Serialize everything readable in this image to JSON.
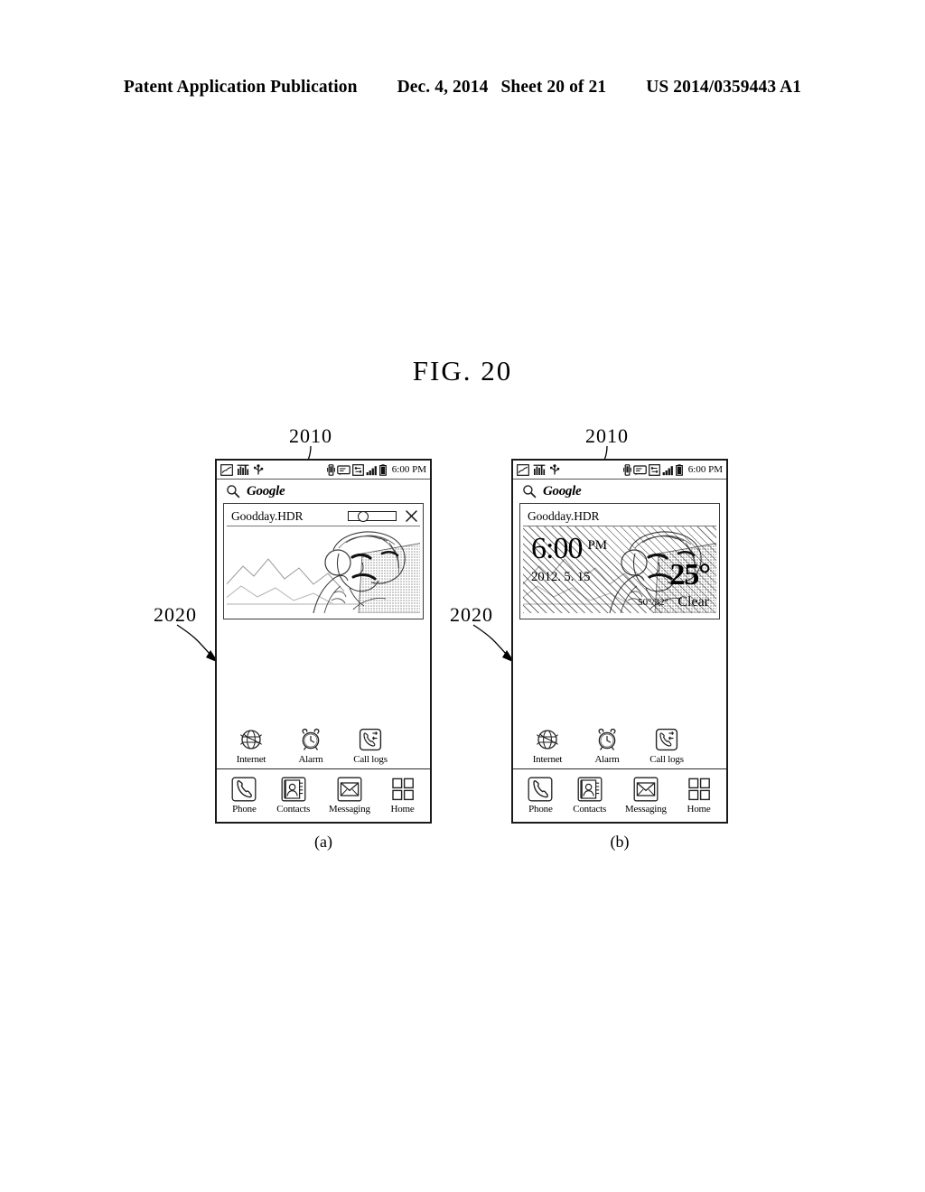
{
  "header": {
    "publication": "Patent Application Publication",
    "date": "Dec. 4, 2014",
    "sheet": "Sheet 20 of 21",
    "number": "US 2014/0359443 A1"
  },
  "figure": {
    "title": "FIG. 20",
    "ref_2010": "2010",
    "ref_2020": "2020",
    "caption_a": "(a)",
    "caption_b": "(b)"
  },
  "status_bar": {
    "left_icons": [
      "image-icon",
      "equalizer-icon",
      "usb-icon"
    ],
    "right_icons": [
      "vibrate-icon",
      "message-icon",
      "sync-icon",
      "signal-icon",
      "battery-icon"
    ],
    "time": "6:00 PM"
  },
  "search": {
    "icon": "search-icon",
    "label": "Google"
  },
  "viewer": {
    "filename": "Goodday.HDR",
    "slider_position_percent": 30,
    "close_icon": "close-icon"
  },
  "widget": {
    "time": "6:00",
    "ampm": "PM",
    "date": "2012. 5. 15",
    "temperature": "25°",
    "high_low": "50°/32°",
    "condition": "Clear"
  },
  "apps": [
    {
      "label": "Internet",
      "icon": "globe-icon"
    },
    {
      "label": "Alarm",
      "icon": "alarm-clock-icon"
    },
    {
      "label": "Call logs",
      "icon": "call-logs-icon"
    }
  ],
  "dock": [
    {
      "label": "Phone",
      "icon": "phone-handset-icon"
    },
    {
      "label": "Contacts",
      "icon": "contacts-book-icon"
    },
    {
      "label": "Messaging",
      "icon": "envelope-icon"
    },
    {
      "label": "Home",
      "icon": "app-grid-icon"
    }
  ],
  "colors": {
    "ink": "#000000",
    "frame": "#1a1a1a",
    "paper": "#ffffff"
  }
}
